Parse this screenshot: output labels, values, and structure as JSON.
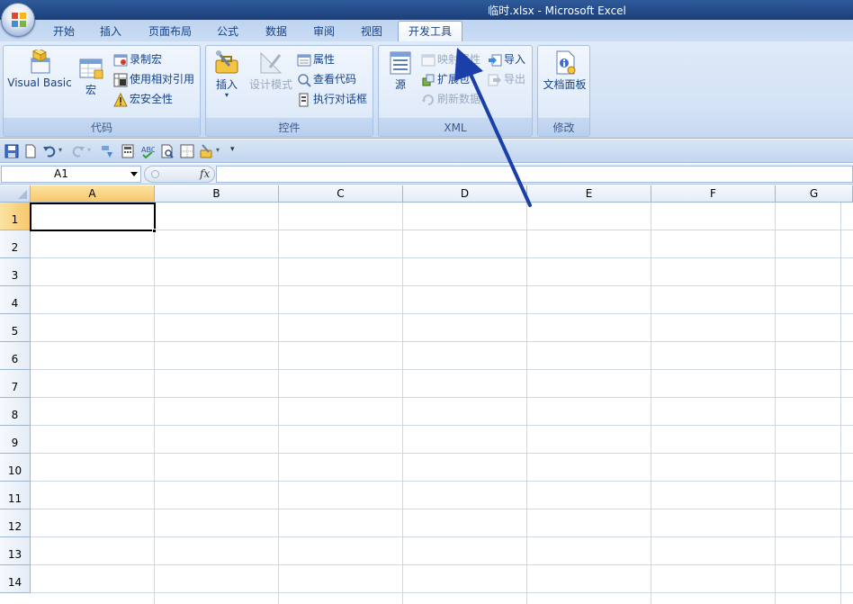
{
  "window": {
    "title": "临时.xlsx - Microsoft Excel"
  },
  "tabs": [
    {
      "label": "开始"
    },
    {
      "label": "插入"
    },
    {
      "label": "页面布局"
    },
    {
      "label": "公式"
    },
    {
      "label": "数据"
    },
    {
      "label": "审阅"
    },
    {
      "label": "视图"
    },
    {
      "label": "开发工具",
      "active": true
    }
  ],
  "ribbon": {
    "code": {
      "label": "代码",
      "visual_basic": "Visual Basic",
      "macros": "宏",
      "record_macro": "录制宏",
      "relative_refs": "使用相对引用",
      "macro_security": "宏安全性"
    },
    "controls": {
      "label": "控件",
      "insert": "插入",
      "design_mode": "设计模式",
      "properties": "属性",
      "view_code": "查看代码",
      "run_dialog": "执行对话框"
    },
    "xml": {
      "label": "XML",
      "source": "源",
      "map_properties": "映射属性",
      "expansion_packs": "扩展包",
      "refresh_data": "刷新数据",
      "import": "导入",
      "export": "导出"
    },
    "modify": {
      "label": "修改",
      "document_panel": "文档面板"
    }
  },
  "formula_bar": {
    "name_box": "A1",
    "fx": "fx",
    "formula": ""
  },
  "grid": {
    "columns": [
      "A",
      "B",
      "C",
      "D",
      "E",
      "F",
      "G"
    ],
    "rows": [
      "1",
      "2",
      "3",
      "4",
      "5",
      "6",
      "7",
      "8",
      "9",
      "10",
      "11",
      "12",
      "13",
      "14"
    ],
    "active_cell": "A1"
  },
  "colors": {
    "title_bar": "#1b3f7a",
    "ribbon_text": "#15428b",
    "selected_header": "#f8c76b",
    "arrow": "#1a3fa8"
  }
}
